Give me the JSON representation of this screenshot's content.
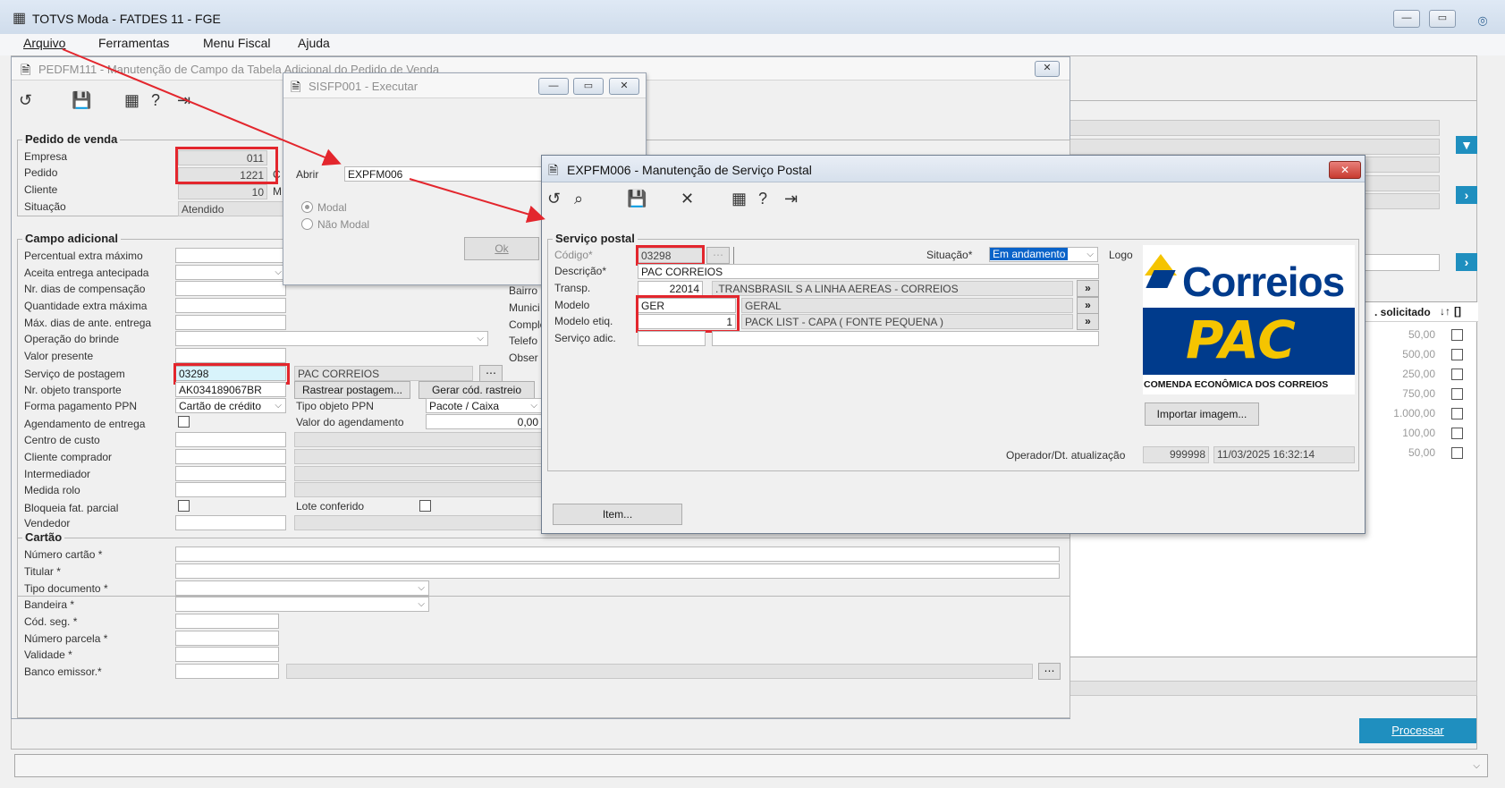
{
  "app": {
    "title": "TOTVS Moda - FATDES 11 - FGE"
  },
  "menu": [
    "Arquivo",
    "Ferramentas",
    "Menu Fiscal",
    "Ajuda"
  ],
  "w1": {
    "title": "PEDFM111 - Manutenção de Campo da Tabela Adicional do Pedido de Venda",
    "pedido_section": "Pedido de venda",
    "labels": {
      "empresa": "Empresa",
      "pedido": "Pedido",
      "cliente": "Cliente",
      "situacao": "Situação"
    },
    "values": {
      "empresa": "011",
      "pedido": "1221",
      "cliente": "10",
      "situacao": "Atendido",
      "partial_c": "C",
      "partial_m": "M"
    },
    "campo_section": "Campo adicional",
    "campo_labels": [
      "Percentual extra máximo",
      "Aceita entrega antecipada",
      "Nr. dias de compensação",
      "Quantidade extra máxima",
      "Máx. dias de ante. entrega",
      "Operação do brinde",
      "Valor presente",
      "Serviço de postagem",
      "Nr. objeto transporte",
      "Forma pagamento PPN",
      "Agendamento de entrega",
      "Centro de custo",
      "Cliente comprador",
      "Intermediador",
      "Medida rolo",
      "Bloqueia fat. parcial",
      "Vendedor"
    ],
    "servico_postagem": "03298",
    "servico_desc": "PAC CORREIOS",
    "nr_objeto": "AK034189067BR",
    "btn_rastrear": "Rastrear postagem...",
    "btn_gerar": "Gerar cód. rastreio",
    "forma_pgto": "Cartão de crédito",
    "tipo_objeto_lbl": "Tipo objeto PPN",
    "tipo_objeto": "Pacote / Caixa",
    "valor_agend_lbl": "Valor do agendamento",
    "valor_agend": "0,00",
    "lote_lbl": "Lote conferido",
    "right_labels": [
      "Bairro",
      "Munici",
      "Comple",
      "Telefo",
      "Obser"
    ],
    "cartao_section": "Cartão",
    "cartao_labels": [
      "Número cartão *",
      "Titular *",
      "Tipo documento *",
      "Bandeira *",
      "Cód. seg. *",
      "Número parcela *",
      "Validade *",
      "Banco emissor.*"
    ]
  },
  "w2": {
    "title": "SISFP001 - Executar",
    "abrir_lbl": "Abrir",
    "abrir_val": "EXPFM006",
    "modal": "Modal",
    "nao_modal": "Não Modal",
    "ok": "Ok"
  },
  "w3": {
    "title": "EXPFM006 - Manutenção de Serviço Postal",
    "section": "Serviço postal",
    "codigo_lbl": "Código*",
    "codigo": "03298",
    "situacao_lbl": "Situação*",
    "situacao": "Em andamento",
    "logo_lbl": "Logo",
    "descricao_lbl": "Descrição*",
    "descricao": "PAC CORREIOS",
    "transp_lbl": "Transp.",
    "transp_code": "22014",
    "transp_name": ".TRANSBRASIL S A LINHA AEREAS - CORREIOS",
    "modelo_lbl": "Modelo",
    "modelo": "GER",
    "modelo_name": "GERAL",
    "modelo_etiq_lbl": "Modelo etiq.",
    "modelo_etiq": "1",
    "modelo_etiq_name": "PACK LIST - CAPA ( FONTE PEQUENA )",
    "servico_adic_lbl": "Serviço adic.",
    "logo_text1": "Correios",
    "logo_text2": "PAC",
    "logo_text3": "COMENDA ECONÔMICA DOS CORREIOS",
    "importar": "Importar imagem...",
    "operador_lbl": "Operador/Dt. atualização",
    "operador": "999998",
    "dt_atual": "11/03/2025 16:32:14",
    "item_btn": "Item..."
  },
  "bg": {
    "col_header": ". solicitado",
    "col_sort": "↓↑",
    "col_bracket": "[]",
    "values": [
      "50,00",
      "500,00",
      "250,00",
      "750,00",
      "1.000,00",
      "100,00",
      "50,00"
    ],
    "processar": "Processar"
  },
  "colors": {
    "red": "#e3262d",
    "accent": "#1f8fbf",
    "correios_blue": "#003b8c",
    "correios_yellow": "#f5c400"
  }
}
